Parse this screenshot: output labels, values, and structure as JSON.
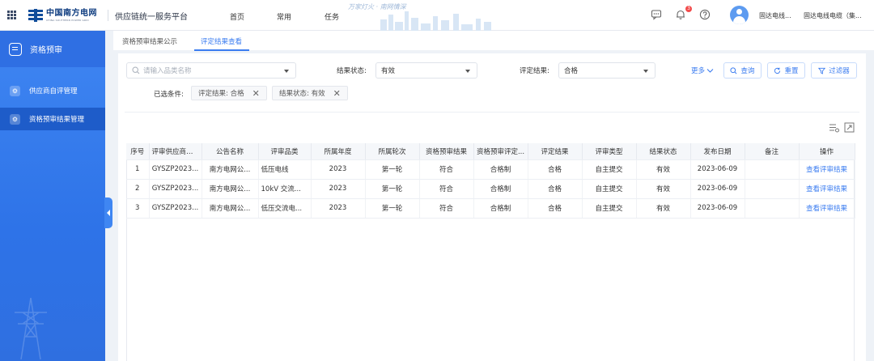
{
  "header": {
    "logo_text": "中国南方电网",
    "logo_subtext": "CHINA SOUTHERN POWER GRID",
    "app_title": "供应链统一服务平台",
    "nav": [
      "首页",
      "常用",
      "任务"
    ],
    "slogan": "万家灯火 · 南网情深",
    "notification_count": "3",
    "user_short": "固达电线...",
    "user_company": "固达电线电缆（集..."
  },
  "sidebar": {
    "title": "资格预审",
    "items": [
      {
        "label": "供应商自评管理",
        "active": false
      },
      {
        "label": "资格预审结果管理",
        "active": true
      }
    ]
  },
  "tabs": [
    {
      "label": "资格预审结果公示",
      "active": false
    },
    {
      "label": "评定结果查看",
      "active": true
    }
  ],
  "filters": {
    "product_placeholder": "请输入品类名称",
    "result_status_label": "结果状态:",
    "result_status_value": "有效",
    "evaluation_result_label": "评定结果:",
    "evaluation_result_value": "合格",
    "more_label": "更多",
    "query_label": "查询",
    "reset_label": "重置",
    "filter_label": "过滤器",
    "selected_label": "已选条件:",
    "chips": [
      "评定结果: 合格",
      "结果状态: 有效"
    ]
  },
  "table": {
    "columns": [
      "序号",
      "评审供应商编码",
      "公告名称",
      "评审品类",
      "所属年度",
      "所属轮次",
      "资格预审结果",
      "资格预审评定...",
      "评定结果",
      "评审类型",
      "结果状态",
      "发布日期",
      "备注",
      "操作"
    ],
    "rows": [
      [
        "1",
        "GYSZP2023...",
        "南方电网公...",
        "低压电线",
        "2023",
        "第一轮",
        "符合",
        "合格制",
        "合格",
        "自主提交",
        "有效",
        "2023-06-09",
        "",
        "查看评审结果"
      ],
      [
        "2",
        "GYSZP2023...",
        "南方电网公...",
        "10kV 交流...",
        "2023",
        "第一轮",
        "符合",
        "合格制",
        "合格",
        "自主提交",
        "有效",
        "2023-06-09",
        "",
        "查看评审结果"
      ],
      [
        "3",
        "GYSZP2023...",
        "南方电网公...",
        "低压交流电...",
        "2023",
        "第一轮",
        "符合",
        "合格制",
        "合格",
        "自主提交",
        "有效",
        "2023-06-09",
        "",
        "查看评审结果"
      ]
    ]
  },
  "colors": {
    "primary": "#3b7cf0",
    "sidebar": "#2f6fe3",
    "badge": "#f24b4b"
  }
}
